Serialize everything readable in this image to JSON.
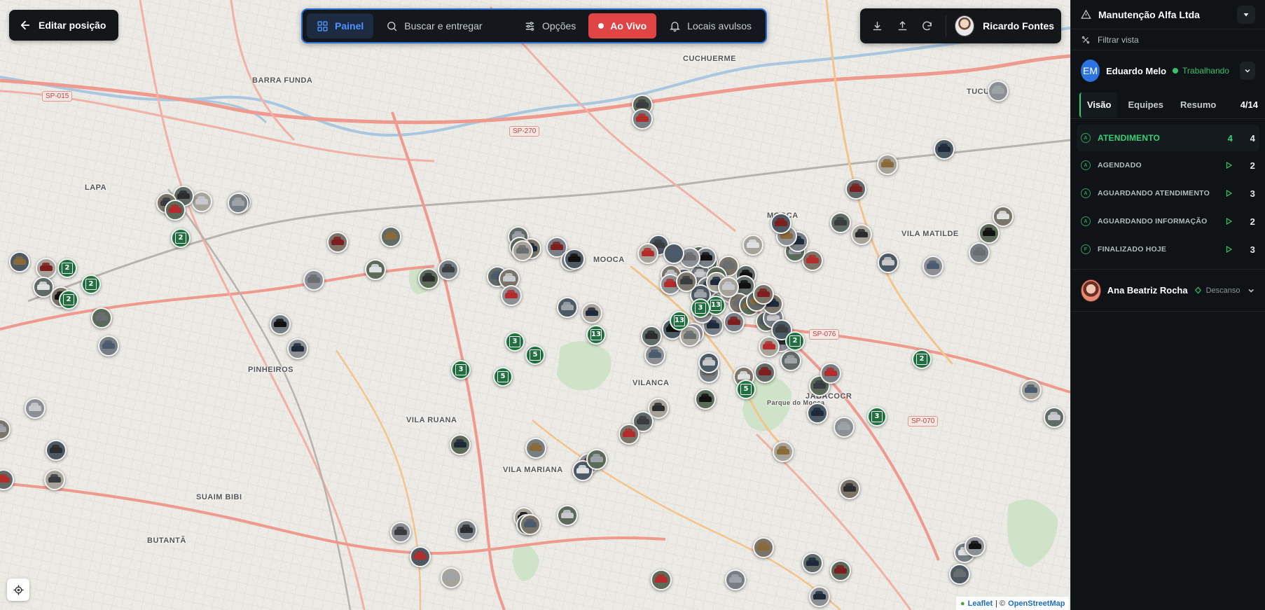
{
  "map": {
    "places": [
      "BARRA FUNDA",
      "LAPA",
      "PINHEIROS",
      "MOOCA",
      "VILA MATILDE",
      "MOOCA",
      "VILA MARIANA",
      "VILANCA",
      "BUTANTÃ",
      "VILA RUANA",
      "SUAIM BIBI",
      "TUCURUVI",
      "CUCHUERME",
      "JABACOCR",
      "Parque do Mooca"
    ],
    "highways": [
      "SP-015",
      "SP-270",
      "SP-070",
      "SP-076"
    ],
    "cluster_counts": [
      "2",
      "2",
      "2",
      "2",
      "3",
      "3",
      "5",
      "5",
      "13",
      "13",
      "13",
      "3",
      "5",
      "2",
      "2",
      "3"
    ]
  },
  "topbar": {
    "back_label": "Editar posição",
    "tabs": {
      "painel": "Painel",
      "buscar": "Buscar e entregar",
      "opcoes": "Opções",
      "ao_vivo": "Ao Vivo",
      "locais": "Locais avulsos"
    },
    "user_name": "Ricardo Fontes"
  },
  "attribution": {
    "leaflet": "Leaflet",
    "separator": "| ©",
    "osm": "OpenStreetMap"
  },
  "sidebar": {
    "org_name": "Manutenção Alfa Ltda",
    "filter_label": "Filtrar vista",
    "agent1": {
      "initials": "EM",
      "name": "Eduardo Melo",
      "status": "Trabalhando"
    },
    "tabs": [
      "Visão",
      "Equipes",
      "Resumo"
    ],
    "tab_count": "4/14",
    "statuses": [
      {
        "label": "ATENDIMENTO",
        "count_a": "4",
        "count_b": "4"
      },
      {
        "label": "AGENDADO",
        "count": "2"
      },
      {
        "label": "AGUARDANDO ATENDIMENTO",
        "count": "3"
      },
      {
        "label": "AGUARDANDO INFORMAÇÃO",
        "count": "2"
      },
      {
        "label": "FINALIZADO HOJE",
        "count": "3"
      }
    ],
    "agent2": {
      "name": "Ana Beatriz Rocha",
      "status": "Descanso"
    }
  },
  "colors": {
    "accent_blue": "#2b6fd6",
    "live_red": "#e04444",
    "status_green": "#33c26b",
    "cluster_green": "#1f6f3f"
  }
}
